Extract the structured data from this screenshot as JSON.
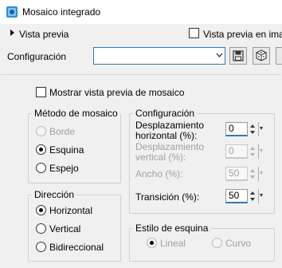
{
  "window": {
    "title": "Mosaico integrado",
    "app_icon": "psp-app-icon"
  },
  "preview": {
    "label": "Vista previa",
    "right_label": "Vista previa en imag",
    "right_checked": false
  },
  "config": {
    "label": "Configuración",
    "value": "",
    "save_icon": "save-icon",
    "random_icon": "dice-icon"
  },
  "mosaic_preview": {
    "label": "Mostrar vista previa de mosaico",
    "checked": false
  },
  "metodo": {
    "title": "Método de mosaico",
    "options": [
      {
        "label": "Borde",
        "checked": false,
        "disabled": true
      },
      {
        "label": "Esquina",
        "checked": true,
        "disabled": false
      },
      {
        "label": "Espejo",
        "checked": false,
        "disabled": false
      }
    ]
  },
  "direccion": {
    "title": "Dirección",
    "options": [
      {
        "label": "Horizontal",
        "checked": true
      },
      {
        "label": "Vertical",
        "checked": false
      },
      {
        "label": "Bidireccional",
        "checked": false
      }
    ]
  },
  "configuracion": {
    "title": "Configuración",
    "fields": [
      {
        "label_line1": "Desplazamiento",
        "label_line2": "horizontal (%):",
        "value": "0",
        "disabled": false
      },
      {
        "label_line1": "Desplazamiento",
        "label_line2": "vertical (%):",
        "value": "0",
        "disabled": true
      },
      {
        "label": "Ancho (%):",
        "value": "50",
        "disabled": true
      },
      {
        "label": "Transición (%):",
        "value": "50",
        "disabled": false
      }
    ]
  },
  "estilo": {
    "title": "Estilo de esquina",
    "options": [
      {
        "label": "Lineal",
        "checked": true,
        "disabled": true
      },
      {
        "label": "Curvo",
        "checked": false,
        "disabled": true
      }
    ]
  }
}
